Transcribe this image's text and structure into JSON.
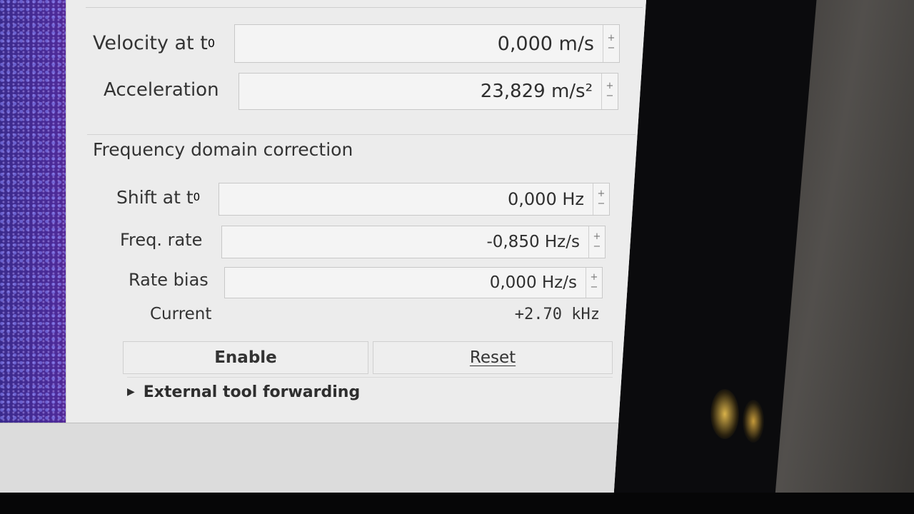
{
  "motion": {
    "velocity": {
      "label_main": "Velocity at t",
      "label_sub": "0",
      "value": "0,000 m/s"
    },
    "acceleration": {
      "label": "Acceleration",
      "value": "23,829 m/s²"
    }
  },
  "freq_correction": {
    "title": "Frequency domain correction",
    "shift": {
      "label_main": "Shift at t",
      "label_sub": "0",
      "value": "0,000 Hz"
    },
    "freq_rate": {
      "label": "Freq. rate",
      "value": "-0,850 Hz/s"
    },
    "rate_bias": {
      "label": "Rate bias",
      "value": "0,000 Hz/s"
    },
    "current": {
      "label": "Current",
      "value": "+2.70 kHz"
    },
    "enable_label": "Enable",
    "reset_label": "Reset"
  },
  "spin_buttons": {
    "up": "+",
    "down": "−"
  },
  "expander": {
    "arrow": "▶",
    "label": "External tool forwarding"
  },
  "colors": {
    "waterfall": "#4b2a98",
    "panel": "#ececec"
  }
}
